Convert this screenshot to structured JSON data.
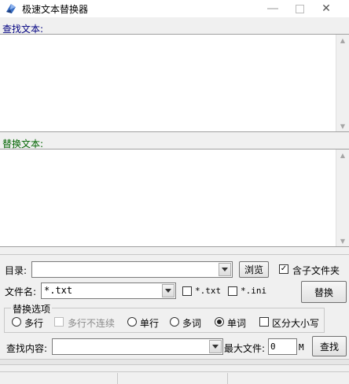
{
  "window": {
    "title": "极速文本替换器",
    "minimize_icon": "minimize-icon",
    "maximize_icon": "maximize-icon",
    "close_icon": "close-icon"
  },
  "find_section": {
    "label": "查找文本:",
    "value": ""
  },
  "replace_section": {
    "label": "替换文本:",
    "value": ""
  },
  "colors": {
    "find_label": "#000080",
    "replace_label": "#006400"
  },
  "directory": {
    "label": "目录:",
    "value": "",
    "browse_label": "浏览",
    "include_subfolders_label": "含子文件夹",
    "include_subfolders_checked": true
  },
  "filename": {
    "label": "文件名:",
    "value": "*.txt",
    "ext_txt_label": "*.txt",
    "ext_txt_checked": false,
    "ext_ini_label": "*.ini",
    "ext_ini_checked": false
  },
  "replace_button_label": "替换",
  "options": {
    "group_title": "替换选项",
    "multiline_label": "多行",
    "multiline_noncontiguous_label": "多行不连续",
    "single_line_label": "单行",
    "multi_word_label": "多词",
    "single_word_label": "单词",
    "case_sensitive_label": "区分大小写",
    "selected": "单词",
    "case_sensitive_checked": false
  },
  "search_content": {
    "label": "查找内容:",
    "value": "",
    "max_file_label": "最大文件:",
    "max_file_value": "0",
    "max_file_unit": "M",
    "find_button_label": "查找"
  }
}
